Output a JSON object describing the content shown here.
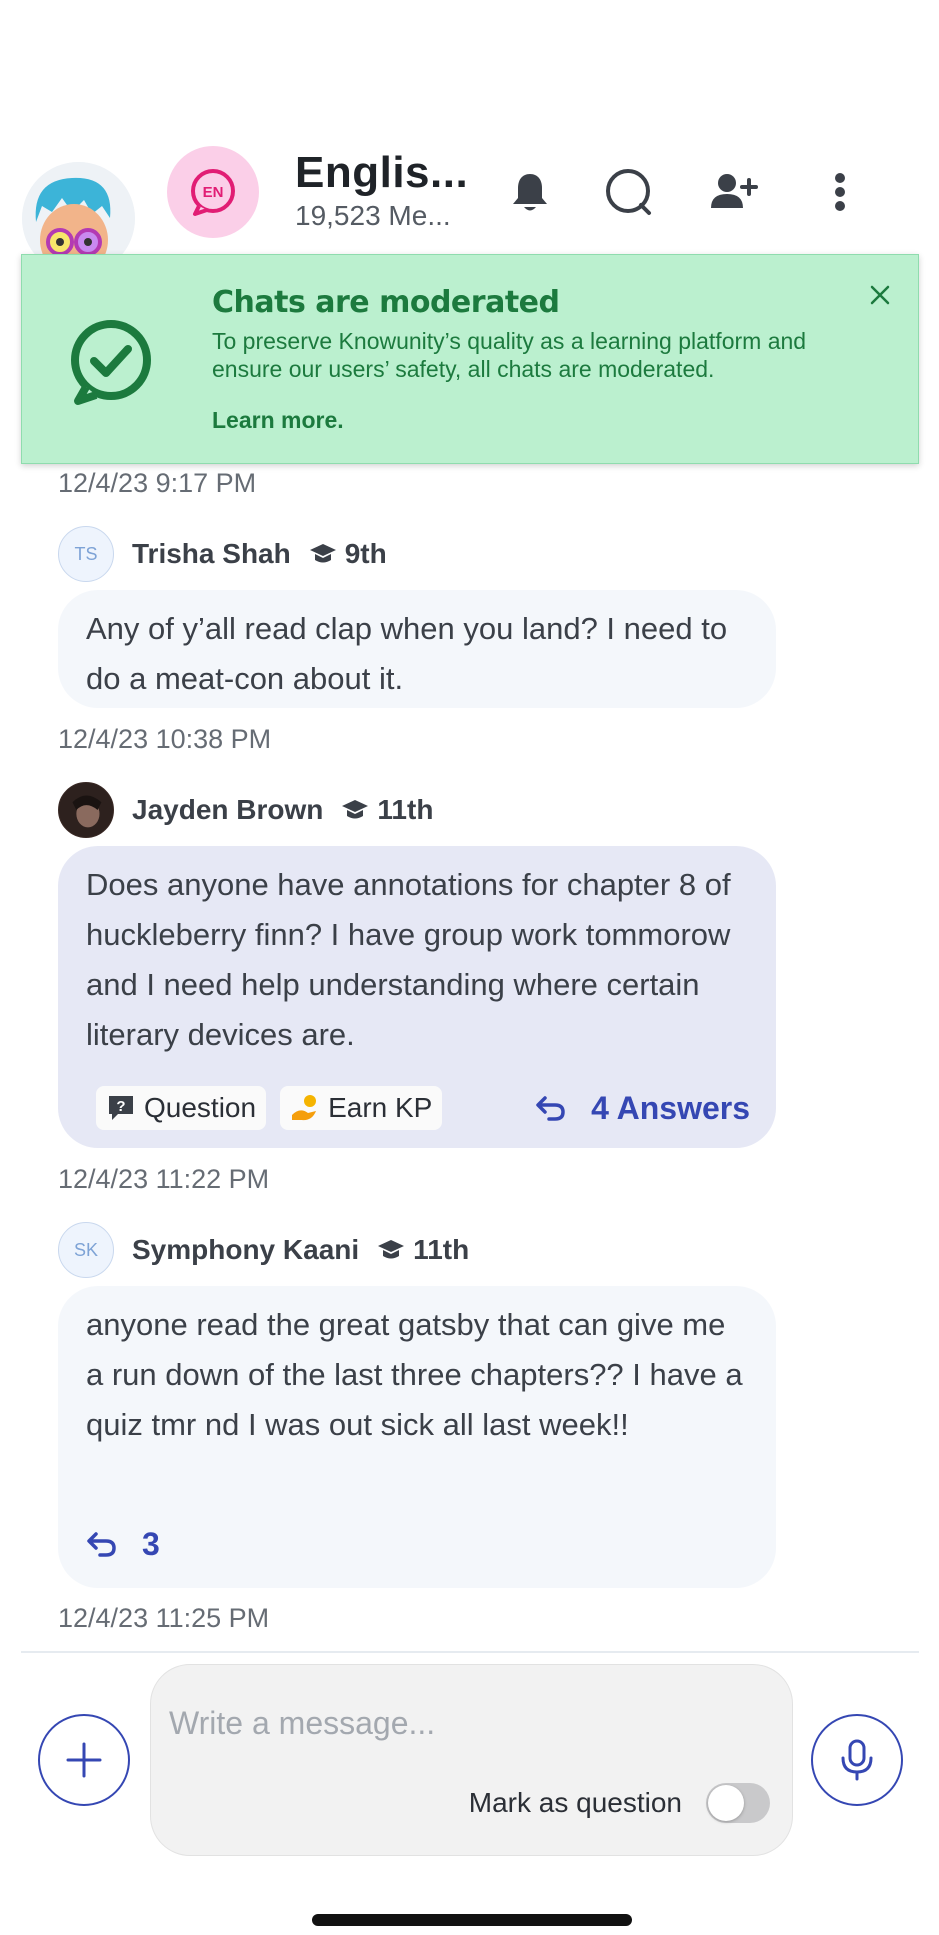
{
  "header": {
    "group_badge": "EN",
    "title": "Englis...",
    "subtitle": "19,523 Me..."
  },
  "banner": {
    "title": "Chats are moderated",
    "text": "To preserve Knowunity’s quality as a learning platform and ensure our users’ safety, all chats are moderated.",
    "link": "Learn more."
  },
  "messages": [
    {
      "timestamp": "12/4/23 9:17 PM",
      "initials": "TS",
      "author": "Trisha Shah",
      "grade": "9th",
      "text": "Any of y’all read clap when you land? I need to do a meat-con about it."
    },
    {
      "timestamp": "12/4/23 10:38 PM",
      "author": "Jayden Brown",
      "grade": "11th",
      "text": "Does anyone have annotations for chapter 8 of huckleberry finn? I have group work tommorow and I need help understanding where certain literary devices are.",
      "tags": [
        "Question",
        "Earn KP"
      ],
      "answers": "4 Answers"
    },
    {
      "timestamp": "12/4/23 11:22 PM",
      "initials": "SK",
      "author": "Symphony Kaani",
      "grade": "11th",
      "text": "anyone read the great gatsby that can give me a run down of the last three chapters?? I have a quiz tmr nd I was out sick all last week!!",
      "replies": "3"
    }
  ],
  "last_timestamp": "12/4/23 11:25 PM",
  "composer": {
    "placeholder": "Write a message...",
    "mark_label": "Mark as question",
    "mark_on": false
  },
  "colors": {
    "accent": "#3547b3",
    "banner_bg": "#bbf0cf",
    "banner_text": "#1c7a3e",
    "group_icon_bg": "#fbcfe8"
  }
}
